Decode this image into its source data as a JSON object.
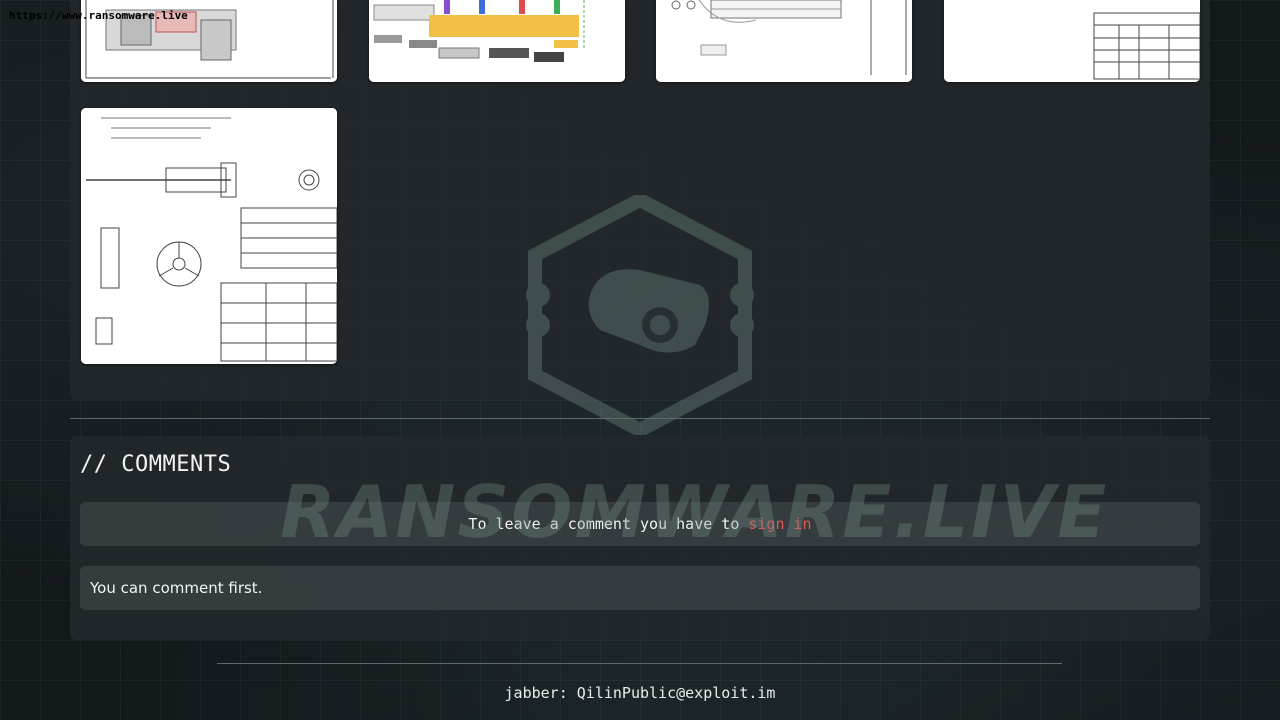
{
  "site": {
    "url": "https://www.ransomware.live"
  },
  "gallery": {
    "thumbnails": [
      {
        "name": "technical-drawing-1"
      },
      {
        "name": "wiring-diagram"
      },
      {
        "name": "technical-drawing-2"
      },
      {
        "name": "revision-table"
      },
      {
        "name": "screw-drawing"
      }
    ]
  },
  "comments": {
    "title": "// COMMENTS",
    "signin_prompt": "To leave a comment you have to",
    "signin_link": "sign in",
    "empty_message": "You can comment first."
  },
  "footer": {
    "contact": "jabber: QilinPublic@exploit.im"
  },
  "watermark": {
    "text": "RANSOMWARE.LIVE"
  },
  "colors": {
    "accent_link": "#e05a52",
    "panel": "#22282b",
    "background": "#161b1e"
  }
}
